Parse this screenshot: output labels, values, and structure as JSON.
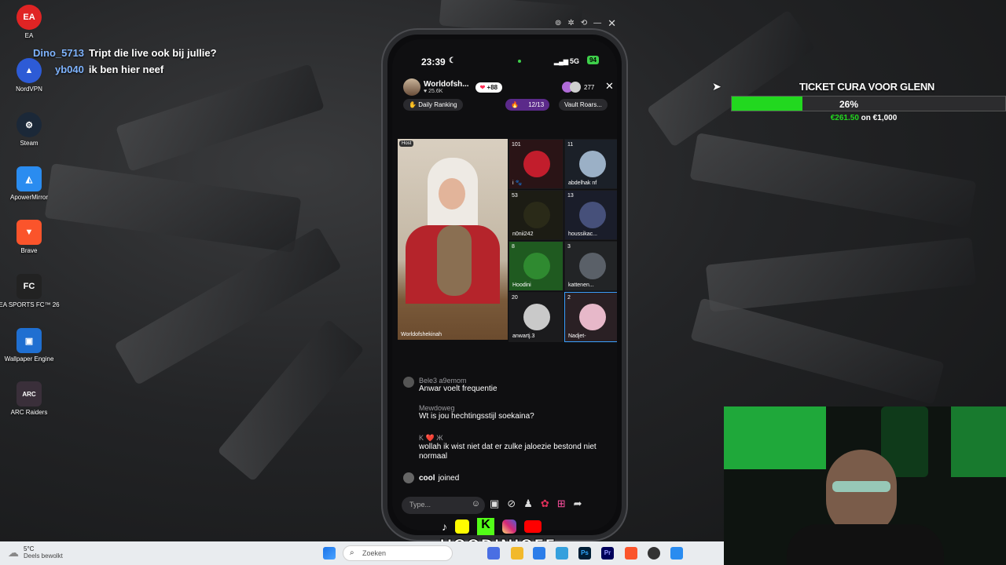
{
  "desktop": {
    "icons": [
      {
        "label": "EA",
        "glyph": "EA",
        "color": "#e02424",
        "icon": "ea-icon"
      },
      {
        "label": "NordVPN",
        "glyph": "▲",
        "color": "#2d5bd6",
        "icon": "nordvpn-icon"
      },
      {
        "label": "Steam",
        "glyph": "⚙",
        "color": "#1b2838",
        "icon": "steam-icon"
      },
      {
        "label": "ApowerMirror",
        "glyph": "◭",
        "color": "#2a8cf0",
        "icon": "apowermirror-icon"
      },
      {
        "label": "Brave",
        "glyph": "▼",
        "color": "#fb542b",
        "icon": "brave-icon"
      },
      {
        "label": "EA SPORTS FC™ 26",
        "glyph": "FC",
        "color": "#222",
        "icon": "ea-sports-fc-icon"
      },
      {
        "label": "Wallpaper Engine",
        "glyph": "▣",
        "color": "#1f6fd1",
        "icon": "wallpaper-engine-icon"
      },
      {
        "label": "ARC Raiders",
        "glyph": "ARC",
        "color": "#3a2f3a",
        "icon": "arc-raiders-icon"
      }
    ]
  },
  "chat_overlay": [
    {
      "user": "Dino_5713",
      "text": "Tript die live ook bij jullie?"
    },
    {
      "user": "yb040",
      "text": "ik ben hier neef"
    }
  ],
  "phone": {
    "time": "23:39",
    "network": "5G",
    "battery": "94",
    "host_name": "Worldofsh...",
    "host_followers": "25.6K",
    "likes_badge": "+88",
    "viewer_count": "277",
    "daily_ranking": "Daily Ranking",
    "progress": "12/13",
    "vault_label": "Vault Roars...",
    "host_tag": "Host",
    "host_label": "Worldofshekinah",
    "guests": [
      {
        "count": "101",
        "name": "i 🐾"
      },
      {
        "count": "11",
        "name": "abdelhak nf"
      },
      {
        "count": "53",
        "name": "n0nii242"
      },
      {
        "count": "13",
        "name": "houssikac..."
      },
      {
        "count": "8",
        "name": "Hoodini"
      },
      {
        "count": "3",
        "name": "kattenen..."
      },
      {
        "count": "20",
        "name": "anwartj.3"
      },
      {
        "count": "2",
        "name": "Nadjet-"
      }
    ],
    "comments": [
      {
        "user": "Bele3 a9emom",
        "text": "Anwar voelt frequentie"
      },
      {
        "user": "Mewdoweg",
        "text": "Wt is jou hechtingsstijl soekaina?"
      },
      {
        "user": "K ❤️ Ж",
        "text": "wollah ik wist niet dat er zulke jaloezie bestond niet normaal"
      }
    ],
    "joined_user": "cool",
    "joined_text": "joined",
    "input_placeholder": "Type..."
  },
  "goal": {
    "title": "TICKET CURA VOOR GLENN",
    "percent": "26%",
    "fraction": 0.26,
    "amount": "€261.50",
    "separator": "on",
    "target": "€1,000"
  },
  "streamer_name": "HOODINIOFF",
  "taskbar": {
    "weather_temp": "5°C",
    "weather_desc": "Deels bewolkt",
    "search_placeholder": "Zoeken"
  }
}
